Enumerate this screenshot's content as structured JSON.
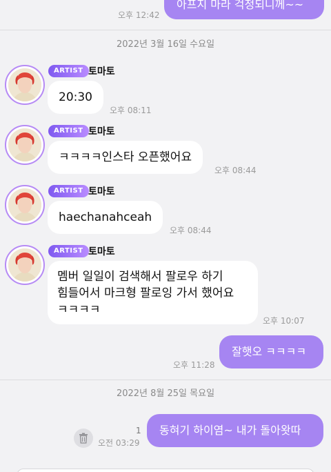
{
  "top_partial": {
    "message": "아프지 마라 걱정되니께~~",
    "time": "오후 12:42"
  },
  "date_dividers": [
    "2022년 3월 16일 수요일",
    "2022년 8월 25일 목요일"
  ],
  "sender": {
    "badge": "ARTIST",
    "name": "토마토"
  },
  "messages_in": [
    {
      "text": "20:30",
      "time": "오후 08:11"
    },
    {
      "text": "ㅋㅋㅋㅋ인스타 오픈했어요",
      "time": "오후 08:44"
    },
    {
      "text": "haechanahceah",
      "time": "오후 08:44"
    },
    {
      "lines": [
        "멤버 일일이 검색해서 팔로우 하기",
        "힘들어서 마크형 팔로잉 가서 했어요",
        "ㅋㅋㅋㅋ"
      ],
      "time": "오후 10:07"
    }
  ],
  "messages_out": [
    {
      "text": "잘햇오 ㅋㅋㅋㅋ",
      "time": "오후 11:28"
    },
    {
      "text": "동혀기 하이염~ 내가 돌아왓따",
      "time": "오전 03:29",
      "unread": "1"
    }
  ],
  "colors": {
    "accent": "#a685f2",
    "badge": "#7f5af0",
    "background": "#f2f2f4"
  },
  "icons": [
    "trash-icon",
    "artist-avatar"
  ]
}
